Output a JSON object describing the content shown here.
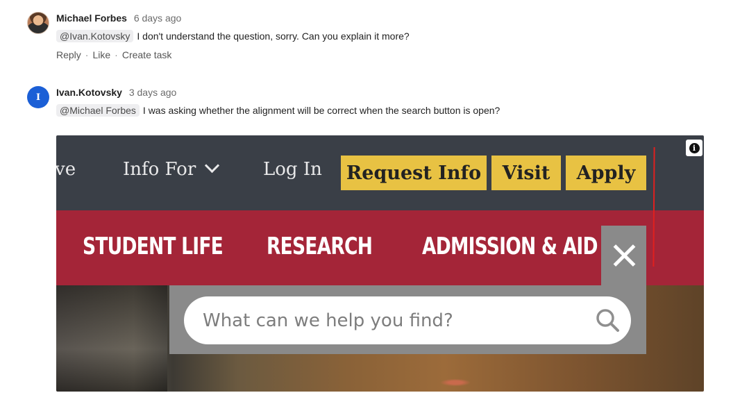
{
  "comments": [
    {
      "author": "Michael Forbes",
      "time": "6 days ago",
      "mention": "@Ivan.Kotovsky",
      "text": "I don't understand the question, sorry. Can you explain it more?",
      "actions": {
        "reply": "Reply",
        "like": "Like",
        "create_task": "Create task",
        "separator": "·"
      }
    },
    {
      "author": "Ivan.Kotovsky",
      "avatar_initial": "I",
      "time": "3 days ago",
      "mention": "@Michael Forbes",
      "text": "I was asking whether the alignment will be correct when the search button is open?"
    }
  ],
  "screenshot": {
    "top_nav": {
      "partial": "ve",
      "info_for": "Info For",
      "log_in": "Log In",
      "request_info": "Request Info",
      "visit": "Visit",
      "apply": "Apply"
    },
    "main_nav": [
      "STUDENT LIFE",
      "RESEARCH",
      "ADMISSION & AID"
    ],
    "search": {
      "placeholder": "What can we help you find?"
    },
    "info_badge": "i"
  },
  "colors": {
    "topbar": "#3a3f47",
    "cta_yellow": "#e8c243",
    "main_red": "#a42538",
    "search_gray": "#8a8a8a",
    "avatar_blue": "#1b5fd6",
    "annotation_red": "#e0201f"
  },
  "icons": [
    "avatar-photo",
    "chevron-down-icon",
    "info-icon",
    "close-icon",
    "search-icon"
  ]
}
